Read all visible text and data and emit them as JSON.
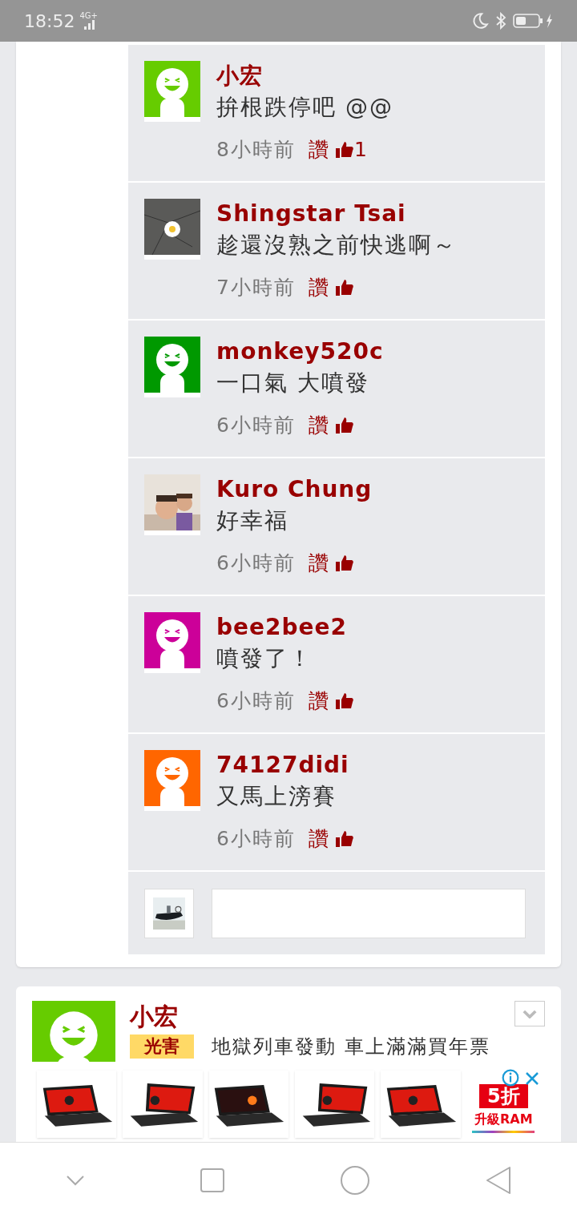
{
  "status_bar": {
    "time": "18:52",
    "network": "4G+"
  },
  "comments": [
    {
      "user": "小宏",
      "text": "拚根跌停吧 @@",
      "time": "8小時前",
      "like_label": "讚",
      "like_count": "1",
      "avatar": {
        "kind": "smiley",
        "color": "#66cc00"
      }
    },
    {
      "user": "Shingstar Tsai",
      "text": "趁還沒熟之前快逃啊～",
      "time": "7小時前",
      "like_label": "讚"
    },
    {
      "user": "monkey520c",
      "text": "一口氣 大噴發",
      "time": "6小時前",
      "like_label": "讚",
      "avatar": {
        "kind": "smiley",
        "color": "#009900"
      }
    },
    {
      "user": "Kuro Chung",
      "text": "好幸福",
      "time": "6小時前",
      "like_label": "讚"
    },
    {
      "user": "bee2bee2",
      "text": "噴發了！",
      "time": "6小時前",
      "like_label": "讚",
      "avatar": {
        "kind": "smiley",
        "color": "#cc0099"
      }
    },
    {
      "user": "74127didi",
      "text": "又馬上滂賽",
      "time": "6小時前",
      "like_label": "讚",
      "avatar": {
        "kind": "smiley",
        "color": "#ff6600"
      }
    }
  ],
  "post": {
    "user": "小宏",
    "avatar": {
      "kind": "smiley",
      "color": "#66cc00"
    },
    "tag": "光害",
    "text": "地獄列車發動 車上滿滿買年票"
  },
  "ad": {
    "promo_badge": "5折",
    "promo_text": "升級RAM"
  }
}
